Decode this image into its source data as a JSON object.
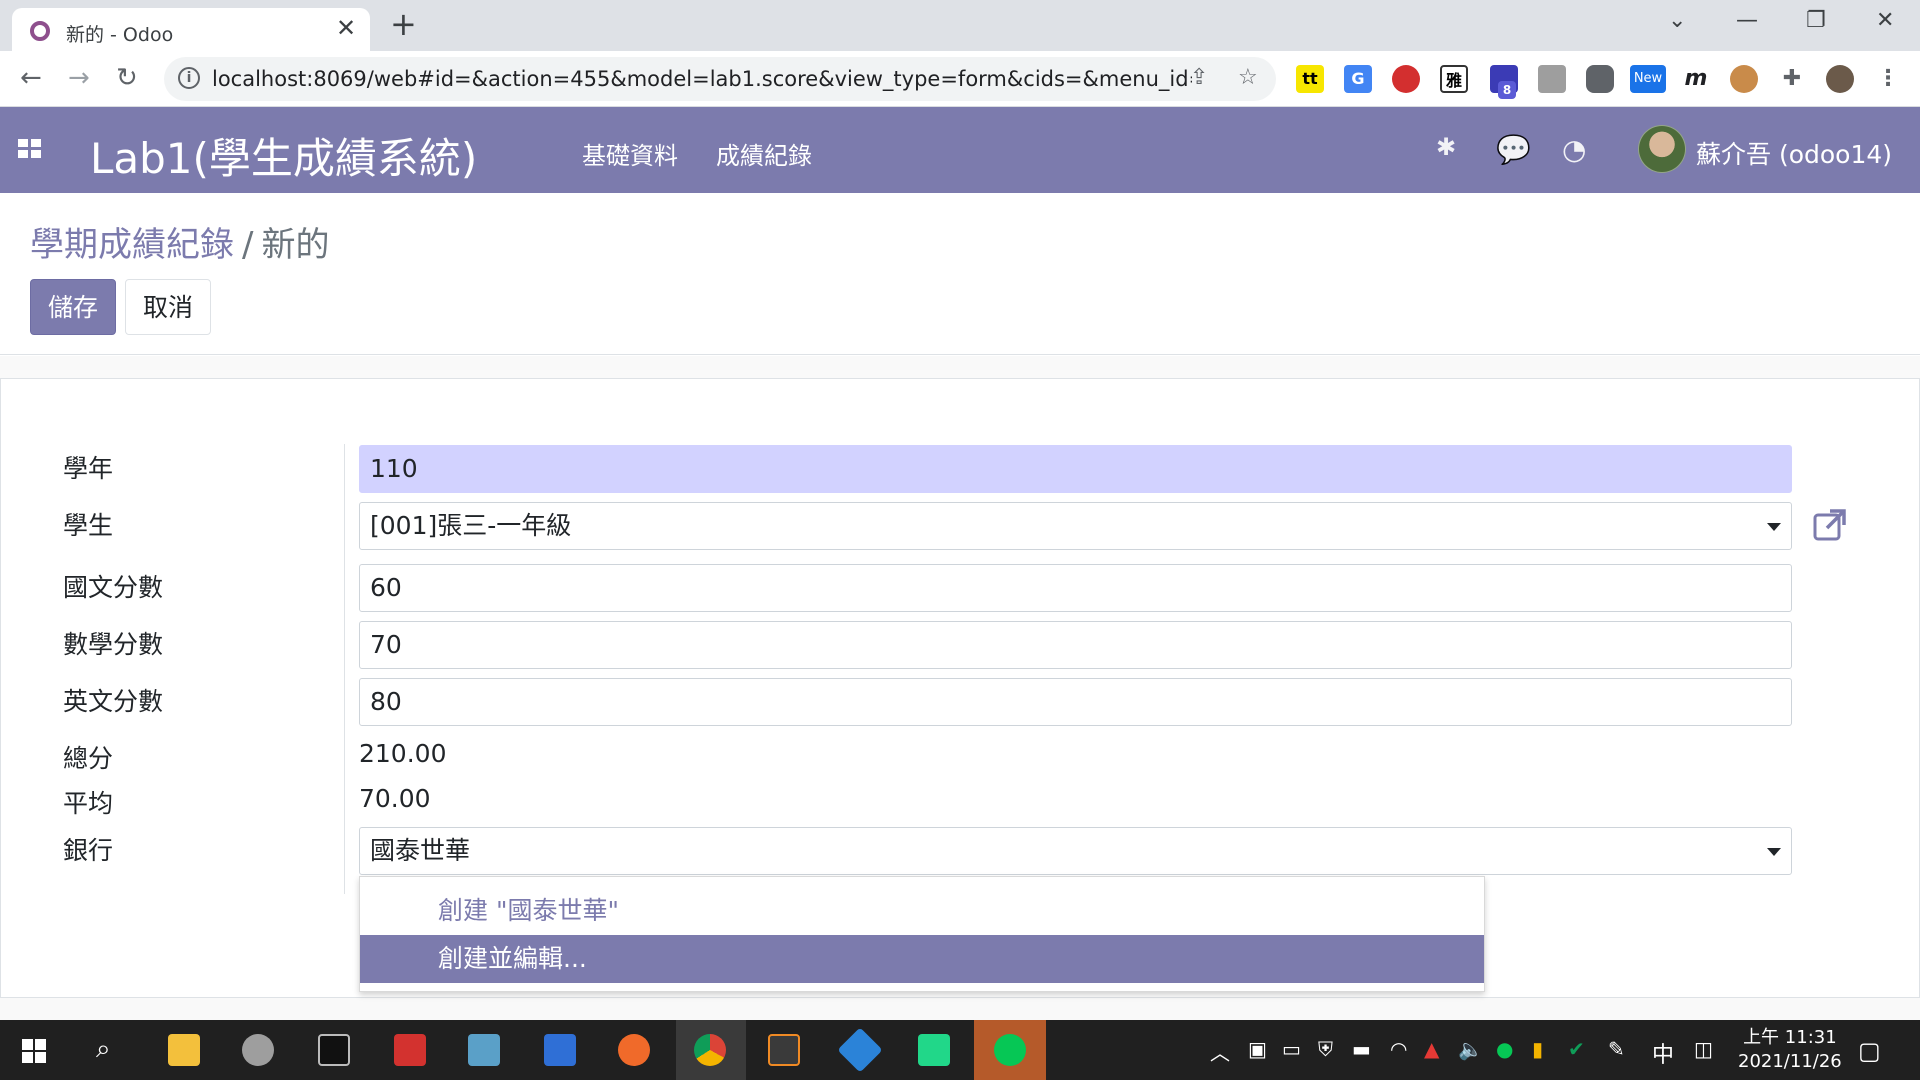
{
  "browser": {
    "tab_title": "新的 - Odoo",
    "url": "localhost:8069/web#id=&action=455&model=lab1.score&view_type=form&cids=&menu_id=...",
    "extension_labels": {
      "tt": "tt",
      "ya": "雅",
      "badge": "8",
      "new": "New",
      "m": "m"
    }
  },
  "navbar": {
    "app_title": "Lab1(學生成績系統)",
    "menus": [
      "基礎資料",
      "成績紀錄"
    ],
    "user": "蘇介吾 (odoo14)",
    "color": "#7c7bad"
  },
  "breadcrumb": {
    "parent": "學期成績紀錄",
    "separator": "/",
    "current": "新的"
  },
  "buttons": {
    "save": "儲存",
    "discard": "取消"
  },
  "form": {
    "year": {
      "label": "學年",
      "value": "110"
    },
    "student": {
      "label": "學生",
      "value": "[001]張三-一年級"
    },
    "chinese": {
      "label": "國文分數",
      "value": "60"
    },
    "math": {
      "label": "數學分數",
      "value": "70"
    },
    "english": {
      "label": "英文分數",
      "value": "80"
    },
    "total": {
      "label": "總分",
      "value": "210.00"
    },
    "average": {
      "label": "平均",
      "value": "70.00"
    },
    "bank": {
      "label": "銀行",
      "value": "國泰世華"
    }
  },
  "dropdown": {
    "create": "創建 \"國泰世華\"",
    "create_edit": "創建並編輯..."
  },
  "taskbar": {
    "time": "上午 11:31",
    "date": "2021/11/26",
    "ime": "中"
  }
}
